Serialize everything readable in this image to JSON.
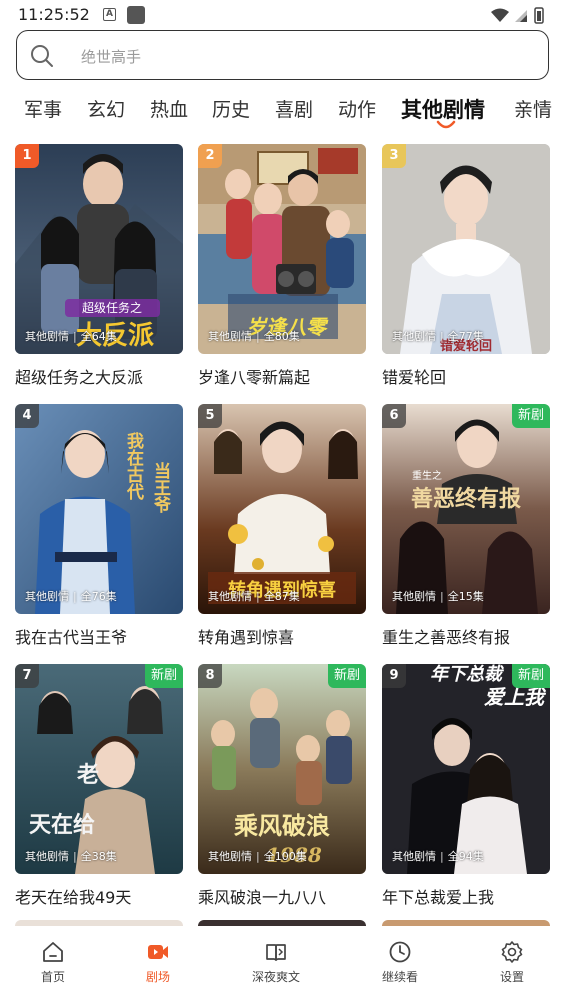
{
  "status_bar": {
    "time": "11:25:52",
    "a_label": "A"
  },
  "search": {
    "placeholder": "绝世高手"
  },
  "tabs": [
    "军事",
    "玄幻",
    "热血",
    "历史",
    "喜剧",
    "动作",
    "其他剧情",
    "亲情"
  ],
  "active_tab": "其他剧情",
  "dramas": [
    {
      "rank": "1",
      "title": "超级任务之大反派",
      "category": "其他剧情",
      "episodes": "全64集",
      "is_new": false
    },
    {
      "rank": "2",
      "title": "岁逢八零新篇起",
      "category": "其他剧情",
      "episodes": "全80集",
      "is_new": false
    },
    {
      "rank": "3",
      "title": "错爱轮回",
      "category": "其他剧情",
      "episodes": "全77集",
      "is_new": false
    },
    {
      "rank": "4",
      "title": "我在古代当王爷",
      "category": "其他剧情",
      "episodes": "全76集",
      "is_new": false
    },
    {
      "rank": "5",
      "title": "转角遇到惊喜",
      "category": "其他剧情",
      "episodes": "全87集",
      "is_new": false
    },
    {
      "rank": "6",
      "title": "重生之善恶终有报",
      "category": "其他剧情",
      "episodes": "全15集",
      "is_new": true
    },
    {
      "rank": "7",
      "title": "老天在给我49天",
      "category": "其他剧情",
      "episodes": "全38集",
      "is_new": true
    },
    {
      "rank": "8",
      "title": "乘风破浪一九八八",
      "category": "其他剧情",
      "episodes": "全100集",
      "is_new": true
    },
    {
      "rank": "9",
      "title": "年下总裁爱上我",
      "category": "其他剧情",
      "episodes": "全94集",
      "is_new": true
    }
  ],
  "new_badge": "新剧",
  "poster_texts": [
    "超级任务之",
    "大反派",
    "岁逢八零",
    "错爱轮回",
    "我在古代",
    "当王爷",
    "转角遇到惊喜",
    "重生之",
    "善恶终有报",
    "老",
    "天在给",
    "乘风破浪",
    "1988",
    "年下总裁",
    "爱上我"
  ],
  "bottom_nav": [
    {
      "label": "首页",
      "icon": "home-icon",
      "active": false
    },
    {
      "label": "剧场",
      "icon": "video-icon",
      "active": true
    },
    {
      "label": "深夜爽文",
      "icon": "book-icon",
      "active": false
    },
    {
      "label": "继续看",
      "icon": "clock-icon",
      "active": false
    },
    {
      "label": "设置",
      "icon": "gear-icon",
      "active": false
    }
  ],
  "colors": {
    "accent": "#f05a28",
    "new_badge": "#2eb85c"
  }
}
